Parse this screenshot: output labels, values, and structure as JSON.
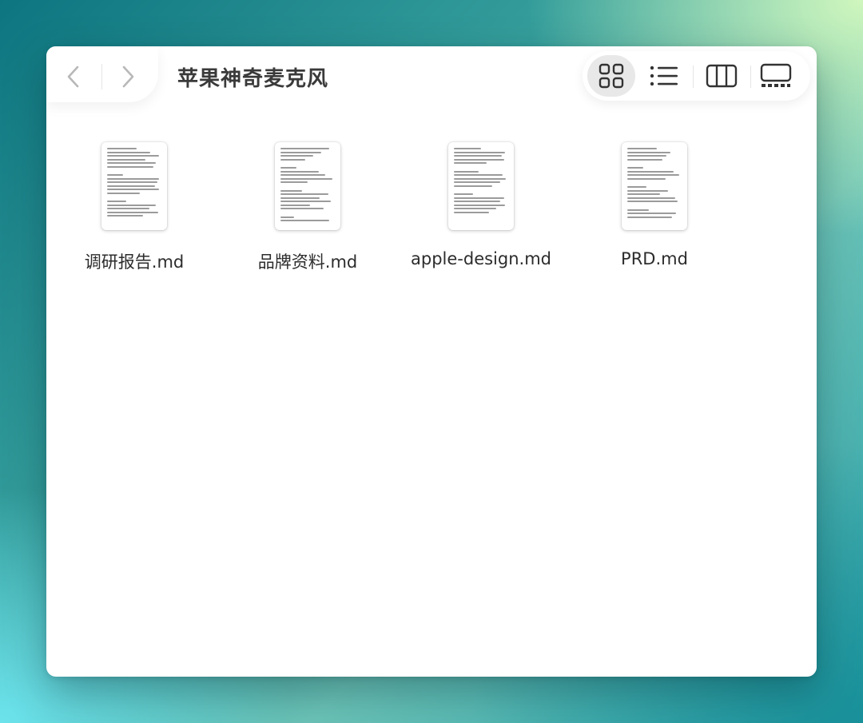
{
  "window": {
    "title": "苹果神奇麦克风"
  },
  "toolbar": {
    "nav": [
      {
        "name": "back-button",
        "icon": "chevron-left-icon"
      },
      {
        "name": "forward-button",
        "icon": "chevron-right-icon"
      }
    ],
    "view_modes": [
      {
        "name": "icon-view",
        "icon": "grid-icon",
        "active": true
      },
      {
        "name": "list-view",
        "icon": "list-icon",
        "active": false
      },
      {
        "name": "column-view",
        "icon": "columns-icon",
        "active": false
      },
      {
        "name": "gallery-view",
        "icon": "gallery-icon",
        "active": false
      }
    ]
  },
  "files": [
    {
      "name": "调研报告.md",
      "icon": "markdown-document-icon"
    },
    {
      "name": "品牌资料.md",
      "icon": "markdown-document-icon"
    },
    {
      "name": "apple-design.md",
      "icon": "markdown-document-icon"
    },
    {
      "name": "PRD.md",
      "icon": "markdown-document-icon"
    }
  ],
  "colors": {
    "window_bg": "#ffffff",
    "title_text": "#3a3a3a",
    "active_view_bg": "#e8e8e8"
  }
}
